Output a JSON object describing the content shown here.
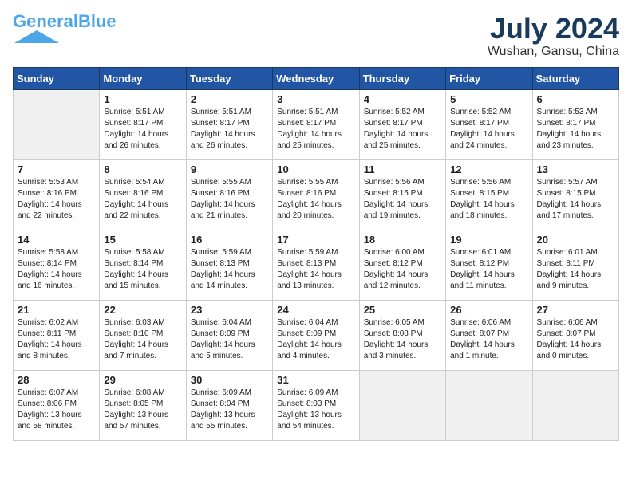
{
  "header": {
    "logo_general": "General",
    "logo_blue": "Blue",
    "month_year": "July 2024",
    "location": "Wushan, Gansu, China"
  },
  "days_of_week": [
    "Sunday",
    "Monday",
    "Tuesday",
    "Wednesday",
    "Thursday",
    "Friday",
    "Saturday"
  ],
  "weeks": [
    [
      {
        "day": null,
        "info": null
      },
      {
        "day": "1",
        "info": "Sunrise: 5:51 AM\nSunset: 8:17 PM\nDaylight: 14 hours\nand 26 minutes."
      },
      {
        "day": "2",
        "info": "Sunrise: 5:51 AM\nSunset: 8:17 PM\nDaylight: 14 hours\nand 26 minutes."
      },
      {
        "day": "3",
        "info": "Sunrise: 5:51 AM\nSunset: 8:17 PM\nDaylight: 14 hours\nand 25 minutes."
      },
      {
        "day": "4",
        "info": "Sunrise: 5:52 AM\nSunset: 8:17 PM\nDaylight: 14 hours\nand 25 minutes."
      },
      {
        "day": "5",
        "info": "Sunrise: 5:52 AM\nSunset: 8:17 PM\nDaylight: 14 hours\nand 24 minutes."
      },
      {
        "day": "6",
        "info": "Sunrise: 5:53 AM\nSunset: 8:17 PM\nDaylight: 14 hours\nand 23 minutes."
      }
    ],
    [
      {
        "day": "7",
        "info": "Sunrise: 5:53 AM\nSunset: 8:16 PM\nDaylight: 14 hours\nand 22 minutes."
      },
      {
        "day": "8",
        "info": "Sunrise: 5:54 AM\nSunset: 8:16 PM\nDaylight: 14 hours\nand 22 minutes."
      },
      {
        "day": "9",
        "info": "Sunrise: 5:55 AM\nSunset: 8:16 PM\nDaylight: 14 hours\nand 21 minutes."
      },
      {
        "day": "10",
        "info": "Sunrise: 5:55 AM\nSunset: 8:16 PM\nDaylight: 14 hours\nand 20 minutes."
      },
      {
        "day": "11",
        "info": "Sunrise: 5:56 AM\nSunset: 8:15 PM\nDaylight: 14 hours\nand 19 minutes."
      },
      {
        "day": "12",
        "info": "Sunrise: 5:56 AM\nSunset: 8:15 PM\nDaylight: 14 hours\nand 18 minutes."
      },
      {
        "day": "13",
        "info": "Sunrise: 5:57 AM\nSunset: 8:15 PM\nDaylight: 14 hours\nand 17 minutes."
      }
    ],
    [
      {
        "day": "14",
        "info": "Sunrise: 5:58 AM\nSunset: 8:14 PM\nDaylight: 14 hours\nand 16 minutes."
      },
      {
        "day": "15",
        "info": "Sunrise: 5:58 AM\nSunset: 8:14 PM\nDaylight: 14 hours\nand 15 minutes."
      },
      {
        "day": "16",
        "info": "Sunrise: 5:59 AM\nSunset: 8:13 PM\nDaylight: 14 hours\nand 14 minutes."
      },
      {
        "day": "17",
        "info": "Sunrise: 5:59 AM\nSunset: 8:13 PM\nDaylight: 14 hours\nand 13 minutes."
      },
      {
        "day": "18",
        "info": "Sunrise: 6:00 AM\nSunset: 8:12 PM\nDaylight: 14 hours\nand 12 minutes."
      },
      {
        "day": "19",
        "info": "Sunrise: 6:01 AM\nSunset: 8:12 PM\nDaylight: 14 hours\nand 11 minutes."
      },
      {
        "day": "20",
        "info": "Sunrise: 6:01 AM\nSunset: 8:11 PM\nDaylight: 14 hours\nand 9 minutes."
      }
    ],
    [
      {
        "day": "21",
        "info": "Sunrise: 6:02 AM\nSunset: 8:11 PM\nDaylight: 14 hours\nand 8 minutes."
      },
      {
        "day": "22",
        "info": "Sunrise: 6:03 AM\nSunset: 8:10 PM\nDaylight: 14 hours\nand 7 minutes."
      },
      {
        "day": "23",
        "info": "Sunrise: 6:04 AM\nSunset: 8:09 PM\nDaylight: 14 hours\nand 5 minutes."
      },
      {
        "day": "24",
        "info": "Sunrise: 6:04 AM\nSunset: 8:09 PM\nDaylight: 14 hours\nand 4 minutes."
      },
      {
        "day": "25",
        "info": "Sunrise: 6:05 AM\nSunset: 8:08 PM\nDaylight: 14 hours\nand 3 minutes."
      },
      {
        "day": "26",
        "info": "Sunrise: 6:06 AM\nSunset: 8:07 PM\nDaylight: 14 hours\nand 1 minute."
      },
      {
        "day": "27",
        "info": "Sunrise: 6:06 AM\nSunset: 8:07 PM\nDaylight: 14 hours\nand 0 minutes."
      }
    ],
    [
      {
        "day": "28",
        "info": "Sunrise: 6:07 AM\nSunset: 8:06 PM\nDaylight: 13 hours\nand 58 minutes."
      },
      {
        "day": "29",
        "info": "Sunrise: 6:08 AM\nSunset: 8:05 PM\nDaylight: 13 hours\nand 57 minutes."
      },
      {
        "day": "30",
        "info": "Sunrise: 6:09 AM\nSunset: 8:04 PM\nDaylight: 13 hours\nand 55 minutes."
      },
      {
        "day": "31",
        "info": "Sunrise: 6:09 AM\nSunset: 8:03 PM\nDaylight: 13 hours\nand 54 minutes."
      },
      {
        "day": null,
        "info": null
      },
      {
        "day": null,
        "info": null
      },
      {
        "day": null,
        "info": null
      }
    ]
  ]
}
